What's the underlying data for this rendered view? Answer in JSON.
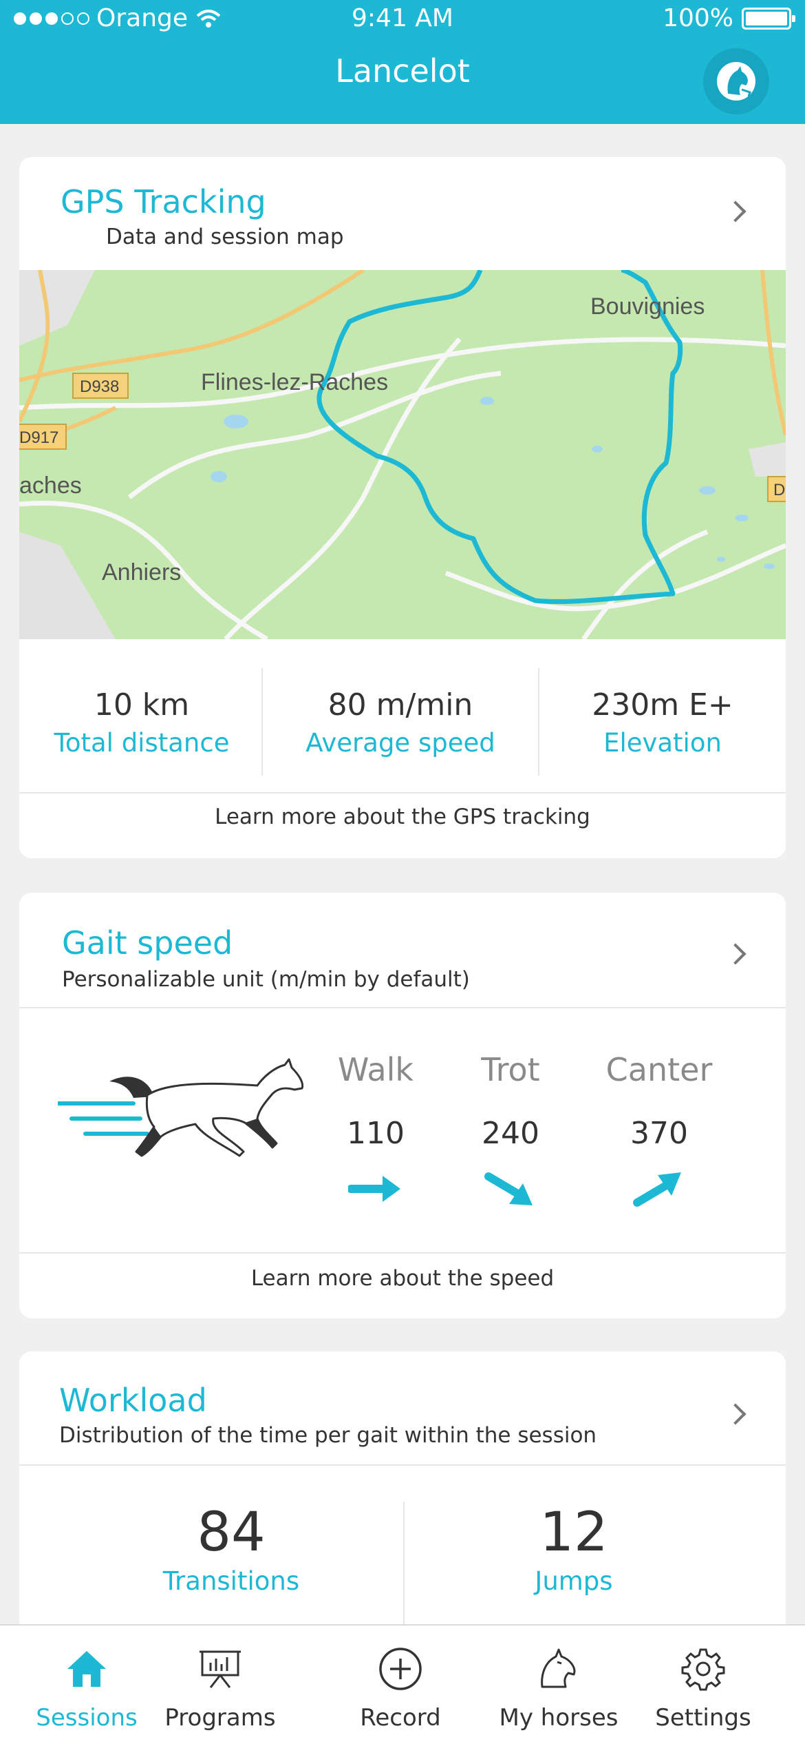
{
  "status_bar": {
    "carrier": "Orange",
    "time": "9:41 AM",
    "battery": "100%"
  },
  "header": {
    "title": "Lancelot",
    "avatar_icon": "horse-head-icon"
  },
  "gps_card": {
    "title": "GPS Tracking",
    "subtitle": "Data and session map",
    "map_labels": {
      "town1": "Bouvignies",
      "town2": "Flines-lez-Raches",
      "town3": "Anhiers",
      "town4": "aches",
      "road1": "D938",
      "road2": "D917",
      "road3": "D"
    },
    "stats": [
      {
        "value": "10 km",
        "label": "Total distance"
      },
      {
        "value": "80 m/min",
        "label": "Average speed"
      },
      {
        "value": "230m E+",
        "label": "Elevation"
      }
    ],
    "footer": "Learn more about the GPS tracking"
  },
  "gait_card": {
    "title": "Gait speed",
    "subtitle": "Personalizable unit (m/min by default)",
    "gaits": [
      {
        "name": "Walk",
        "value": "110",
        "trend": "steady"
      },
      {
        "name": "Trot",
        "value": "240",
        "trend": "down"
      },
      {
        "name": "Canter",
        "value": "370",
        "trend": "up"
      }
    ],
    "footer": "Learn more about the speed"
  },
  "workload_card": {
    "title": "Workload",
    "subtitle": "Distribution of the time per gait within the session",
    "stats": [
      {
        "value": "84",
        "label": "Transitions"
      },
      {
        "value": "12",
        "label": "Jumps"
      }
    ]
  },
  "tab_bar": {
    "tabs": [
      {
        "label": "Sessions",
        "icon": "home-icon",
        "active": true
      },
      {
        "label": "Programs",
        "icon": "presentation-board-icon",
        "active": false
      },
      {
        "label": "Record",
        "icon": "plus-circle-icon",
        "active": false
      },
      {
        "label": "My horses",
        "icon": "horse-head-icon",
        "active": false
      },
      {
        "label": "Settings",
        "icon": "gear-icon",
        "active": false
      }
    ]
  },
  "colors": {
    "accent": "#1db8d4",
    "background": "#f0f0f0",
    "map_green": "#c5e8b0"
  }
}
